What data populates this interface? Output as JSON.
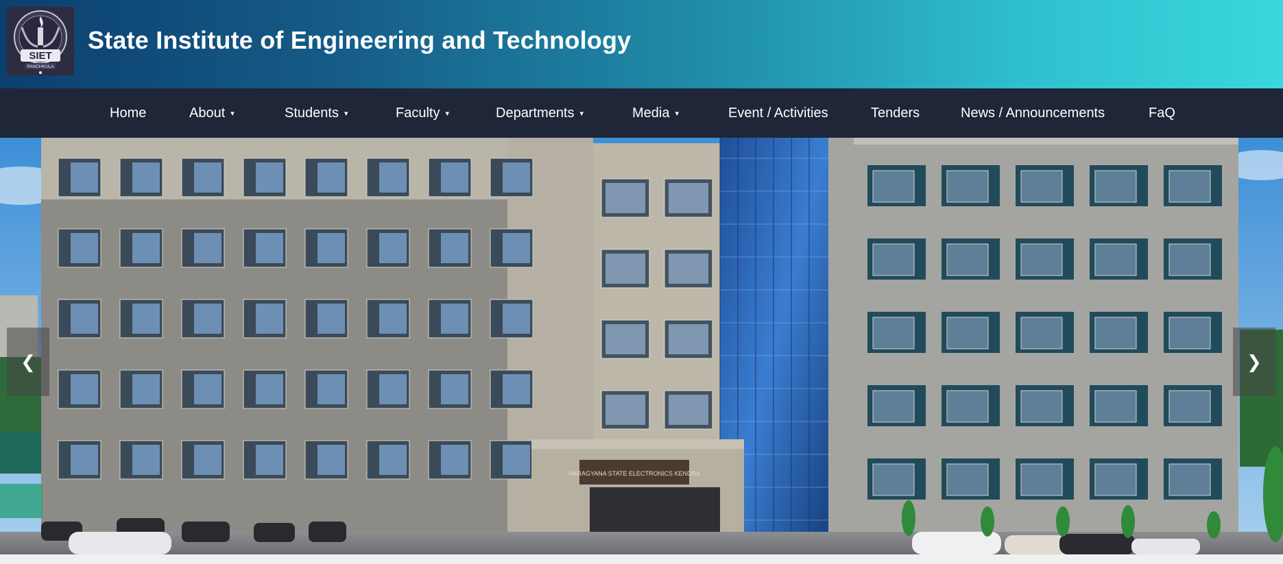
{
  "header": {
    "title": "State Institute of Engineering and Technology",
    "logo": {
      "main_text": "SIET",
      "sub_text": "PANCHKULA"
    }
  },
  "nav": {
    "items": [
      {
        "label": "Home",
        "caret": ""
      },
      {
        "label": "About",
        "caret": "▾"
      },
      {
        "label": "Students",
        "caret": "▾"
      },
      {
        "label": "Faculty",
        "caret": "▾"
      },
      {
        "label": "Departments",
        "caret": "▾"
      },
      {
        "label": "Media",
        "caret": "▾"
      },
      {
        "label": "Event / Activities",
        "caret": ""
      },
      {
        "label": "Tenders",
        "caret": ""
      },
      {
        "label": "News / Announcements",
        "caret": ""
      },
      {
        "label": "FaQ",
        "caret": ""
      }
    ]
  },
  "carousel": {
    "prev_label": "❮",
    "next_label": "❯",
    "building_sign": "HARAGYANA STATE ELECTRONICS KENDRA"
  },
  "colors": {
    "header_gradient_start": "#0b3f6e",
    "header_gradient_end": "#3ad8dc",
    "nav_background": "#1e2638"
  }
}
